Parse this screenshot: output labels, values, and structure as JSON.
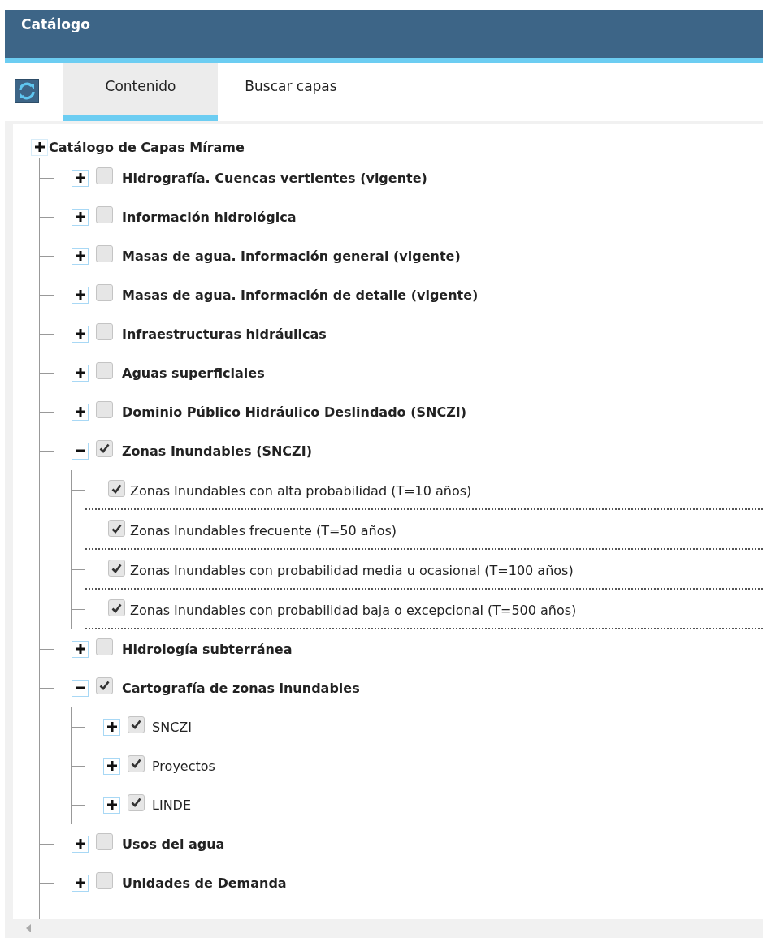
{
  "panel": {
    "title": "Catálogo"
  },
  "tabs": [
    {
      "label": "Contenido",
      "selected": true
    },
    {
      "label": "Buscar capas",
      "selected": false
    }
  ],
  "tree": {
    "label": "Catálogo de Capas Mírame",
    "expanded": false,
    "children": [
      {
        "kind": "group",
        "label": "Hidrografía. Cuencas vertientes (vigente)",
        "expanded": false,
        "checked": false
      },
      {
        "kind": "group",
        "label": "Información hidrológica",
        "expanded": false,
        "checked": false
      },
      {
        "kind": "group",
        "label": "Masas de agua. Información general (vigente)",
        "expanded": false,
        "checked": false
      },
      {
        "kind": "group",
        "label": "Masas de agua. Información de detalle (vigente)",
        "expanded": false,
        "checked": false
      },
      {
        "kind": "group",
        "label": "Infraestructuras hidráulicas",
        "expanded": false,
        "checked": false
      },
      {
        "kind": "group",
        "label": "Aguas superficiales",
        "expanded": false,
        "checked": false
      },
      {
        "kind": "group",
        "label": "Dominio Público Hidráulico Deslindado (SNCZI)",
        "expanded": false,
        "checked": false
      },
      {
        "kind": "group",
        "label": "Zonas Inundables (SNCZI)",
        "expanded": true,
        "checked": true,
        "children": [
          {
            "kind": "layer",
            "label": "Zonas Inundables con alta probabilidad (T=10 años)",
            "checked": true
          },
          {
            "kind": "layer",
            "label": "Zonas Inundables frecuente (T=50 años)",
            "checked": true
          },
          {
            "kind": "layer",
            "label": "Zonas Inundables con probabilidad media u ocasional (T=100 años)",
            "checked": true
          },
          {
            "kind": "layer",
            "label": "Zonas Inundables con probabilidad baja o excepcional (T=500 años)",
            "checked": true
          }
        ]
      },
      {
        "kind": "group",
        "label": "Hidrología subterránea",
        "expanded": false,
        "checked": false
      },
      {
        "kind": "group",
        "label": "Cartografía de zonas inundables",
        "expanded": true,
        "checked": true,
        "children": [
          {
            "kind": "group",
            "label": "SNCZI",
            "expanded": false,
            "checked": true
          },
          {
            "kind": "group",
            "label": "Proyectos",
            "expanded": false,
            "checked": true
          },
          {
            "kind": "group",
            "label": "LINDE",
            "expanded": false,
            "checked": true
          }
        ]
      },
      {
        "kind": "group",
        "label": "Usos del agua",
        "expanded": false,
        "checked": false
      },
      {
        "kind": "group",
        "label": "Unidades de Demanda",
        "expanded": false,
        "checked": false
      }
    ]
  }
}
